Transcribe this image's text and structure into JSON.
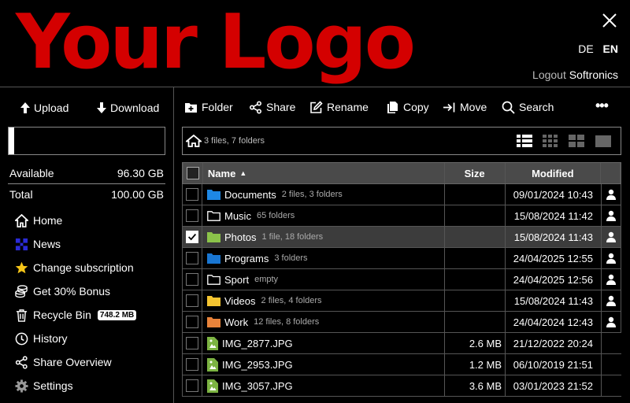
{
  "header": {
    "logo_text": "Your Logo",
    "languages": [
      "DE",
      "EN"
    ],
    "active_language": "EN",
    "logout_label": "Logout",
    "username": "Softronics"
  },
  "sidebar": {
    "upload_label": "Upload",
    "download_label": "Download",
    "usage_fraction": 0.037,
    "available_label": "Available",
    "available_value": "96.30 GB",
    "total_label": "Total",
    "total_value": "100.00 GB",
    "menu": [
      {
        "label": "Home",
        "icon": "home-icon"
      },
      {
        "label": "News",
        "icon": "news-icon"
      },
      {
        "label": "Change subscription",
        "icon": "star-icon"
      },
      {
        "label": "Get 30% Bonus",
        "icon": "coins-icon"
      },
      {
        "label": "Recycle Bin",
        "icon": "trash-icon",
        "badge": "748.2 MB"
      },
      {
        "label": "History",
        "icon": "clock-icon"
      },
      {
        "label": "Share Overview",
        "icon": "share-icon"
      },
      {
        "label": "Settings",
        "icon": "gear-icon"
      }
    ]
  },
  "toolbar": {
    "folder": "Folder",
    "share": "Share",
    "rename": "Rename",
    "copy": "Copy",
    "move": "Move",
    "search": "Search",
    "more": "•••"
  },
  "breadcrumb": {
    "info": "3 files, 7 folders"
  },
  "table": {
    "headers": {
      "name": "Name",
      "size": "Size",
      "modified": "Modified"
    },
    "sort_indicator": "▲",
    "rows": [
      {
        "name": "Documents",
        "meta": "2 files, 3 folders",
        "size": "",
        "modified": "09/01/2024 10:43",
        "type": "folder",
        "color": "#1e88e5",
        "selected": false
      },
      {
        "name": "Music",
        "meta": "65 folders",
        "size": "",
        "modified": "15/08/2024 11:42",
        "type": "folder",
        "color": "outline",
        "selected": false
      },
      {
        "name": "Photos",
        "meta": "1 file, 18 folders",
        "size": "",
        "modified": "15/08/2024 11:43",
        "type": "folder",
        "color": "#8bc34a",
        "selected": true
      },
      {
        "name": "Programs",
        "meta": "3 folders",
        "size": "",
        "modified": "24/04/2025 12:55",
        "type": "folder",
        "color": "#1976d2",
        "selected": false
      },
      {
        "name": "Sport",
        "meta": "empty",
        "size": "",
        "modified": "24/04/2025 12:56",
        "type": "folder",
        "color": "outline",
        "selected": false
      },
      {
        "name": "Videos",
        "meta": "2 files, 4 folders",
        "size": "",
        "modified": "15/08/2024 11:43",
        "type": "folder",
        "color": "#f4c430",
        "selected": false
      },
      {
        "name": "Work",
        "meta": "12 files, 8 folders",
        "size": "",
        "modified": "24/04/2024 12:43",
        "type": "folder",
        "color": "#e8833a",
        "selected": false
      },
      {
        "name": "IMG_2877.JPG",
        "meta": "",
        "size": "2.6 MB",
        "modified": "21/12/2022 20:24",
        "type": "image",
        "color": "#7cb342",
        "selected": false
      },
      {
        "name": "IMG_2953.JPG",
        "meta": "",
        "size": "1.2 MB",
        "modified": "06/10/2019 21:51",
        "type": "image",
        "color": "#7cb342",
        "selected": false
      },
      {
        "name": "IMG_3057.JPG",
        "meta": "",
        "size": "3.6 MB",
        "modified": "03/01/2023 21:52",
        "type": "image",
        "color": "#7cb342",
        "selected": false
      }
    ]
  }
}
